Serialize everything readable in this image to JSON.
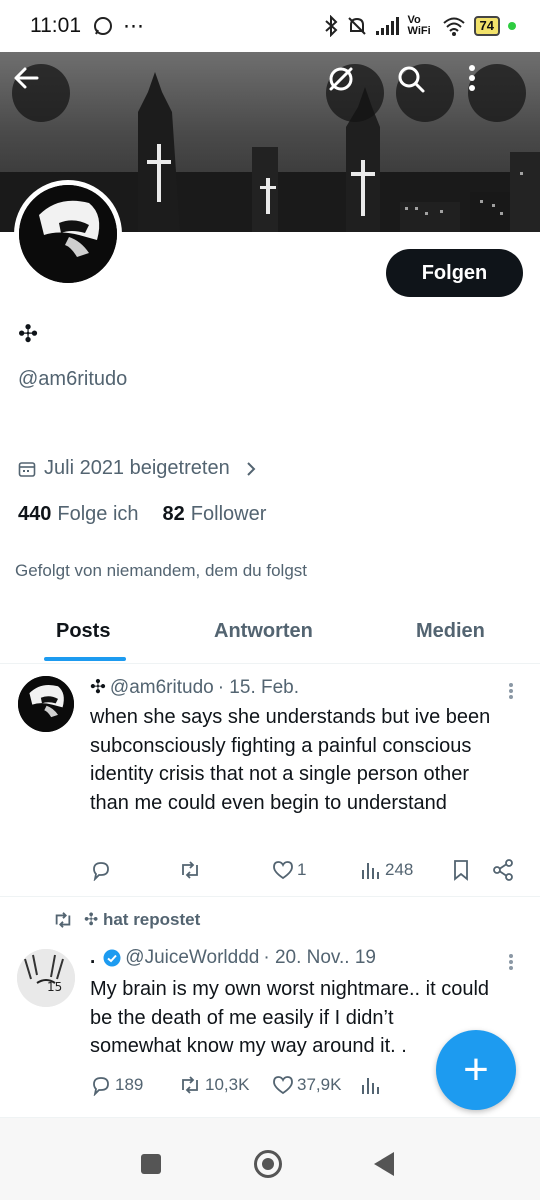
{
  "status_bar": {
    "time": "11:01",
    "more": "⋯",
    "network": "Vo WiFi",
    "battery": "74"
  },
  "profile": {
    "display_name_glyph": "✣",
    "handle": "@am6ritudo",
    "follow_label": "Folgen",
    "joined": "Juli 2021 beigetreten",
    "following_count": "440",
    "following_label": "Folge ich",
    "followers_count": "82",
    "followers_label": "Follower",
    "followed_by": "Gefolgt von niemandem, dem du folgst"
  },
  "tabs": [
    {
      "label": "Posts",
      "active": true
    },
    {
      "label": "Antworten",
      "active": false
    },
    {
      "label": "Medien",
      "active": false
    }
  ],
  "posts": [
    {
      "author_glyph": "✣",
      "handle": "@am6ritudo",
      "date": "· 15. Feb.",
      "text": "when she says she understands but ive been subconsciously fighting a painful conscious identity crisis that not a single person other than me could even begin to understand",
      "replies": "",
      "reposts": "",
      "likes": "1",
      "views": "248"
    },
    {
      "repost_label": "✣ hat repostet",
      "author_name": ".",
      "handle": "@JuiceWorlddd",
      "date": "· 20. Nov.. 19",
      "text": "My brain is my own worst nightmare.. it could be the death of me easily if I didn’t somewhat know my way around it. .",
      "replies": "189",
      "reposts": "10,3K",
      "likes": "37,9K"
    }
  ],
  "fab_label": "+"
}
